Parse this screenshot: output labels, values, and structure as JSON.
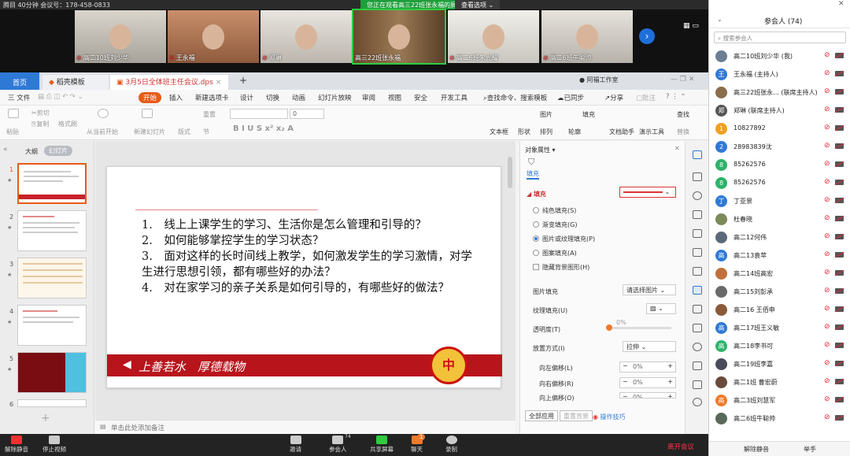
{
  "meeting": {
    "info": "腾目 40分钟 会议号：178-458-0833",
    "viewing_banner": "您正在观看高三22班张永福的屏幕",
    "view_options": "查看选项 ⌄"
  },
  "video_tiles": [
    {
      "name": "高二10班刘少华"
    },
    {
      "name": "王永福"
    },
    {
      "name": "郑琳"
    },
    {
      "name": "高三22班张永福"
    },
    {
      "name": "高二6班朱光耀"
    },
    {
      "name": "高二6班牛聪帅"
    }
  ],
  "wps": {
    "tabs": {
      "home": "首页",
      "template": "稻壳模板",
      "doc": "3月5日全体班主任会议.dps",
      "add": "+"
    },
    "tab_right": "阿福工作室",
    "menu": [
      "三 文件",
      "开始",
      "插入",
      "新建选项卡",
      "设计",
      "切换",
      "动画",
      "幻灯片放映",
      "审阅",
      "视图",
      "安全",
      "开发工具"
    ],
    "menu_right": [
      "查找命令、搜索模板",
      "已同步",
      "分享",
      "批注"
    ],
    "ribbon": {
      "paste": "粘贴",
      "cut": "剪切",
      "copy": "复制",
      "format_painter": "格式刷",
      "from_start": "从当前开始",
      "new_slide": "新建幻灯片",
      "layout": "版式",
      "section": "节",
      "reset": "重置",
      "font_size": "0",
      "textbox": "文本框",
      "shape": "形状",
      "arrange": "排列",
      "outline": "轮廓",
      "picture": "图片",
      "fill": "填充",
      "find": "查找",
      "replace": "替换",
      "doc_assistant": "文档助手",
      "presentation_tools": "演示工具"
    },
    "thumbs_header": {
      "outline": "大纲",
      "slides": "幻灯片"
    },
    "slide_numbers": [
      "1",
      "2",
      "3",
      "4",
      "5",
      "6"
    ],
    "slide": {
      "lines": [
        "1.　线上上课学生的学习、生活你是怎么管理和引导的？",
        "2.　如何能够掌控学生的学习状态？",
        "3.　面对这样的长时间线上教学，如何激发学生的学习激情，对学生进行思想引领，都有哪些好的办法？",
        "4.　对在家学习的亲子关系是如何引导的，有哪些好的做法？"
      ],
      "band_text": "上善若水　厚德载物",
      "seal_text": "中"
    },
    "notes_placeholder": "单击此处添加备注",
    "props": {
      "title": "对象属性 ▾",
      "tab_fill": "填充",
      "section_fill": "◢ 填充",
      "fill_options": [
        "纯色填充(S)",
        "渐变填充(G)",
        "图片或纹理填充(P)",
        "图案填充(A)"
      ],
      "hide_bg": "隐藏背景图形(H)",
      "picture_fill_label": "图片填充",
      "picture_fill_value": "请选择图片",
      "texture_fill_label": "纹理填充(U)",
      "transparency_label": "透明度(T)",
      "transparency_value": "0%",
      "placement_label": "放置方式(I)",
      "placement_value": "拉伸",
      "offset_left_label": "向左偏移(L)",
      "offset_left_value": "0%",
      "offset_right_label": "向右偏移(R)",
      "offset_right_value": "0%",
      "offset_up_label": "向上偏移(O)",
      "offset_up_value": "0%",
      "apply_all": "全部应用",
      "reset_bg": "重置背景",
      "tips": "操作技巧"
    }
  },
  "participants": {
    "title": "参会人 (74)",
    "search_placeholder": "搜索参会人",
    "list": [
      {
        "name": "高二10班刘少华 (我)",
        "avatar": "",
        "color": "#6a7f92"
      },
      {
        "name": "王永福 (主持人)",
        "avatar": "王",
        "color": "#2f79d6"
      },
      {
        "name": "高三22班张永... (联席主持人)",
        "avatar": "",
        "color": "#8a6d4b"
      },
      {
        "name": "郑琳 (联席主持人)",
        "avatar": "郑",
        "color": "#555555"
      },
      {
        "name": "10827892",
        "avatar": "1",
        "color": "#f0a020"
      },
      {
        "name": "28983839沈",
        "avatar": "2",
        "color": "#2f79d6"
      },
      {
        "name": "85262576",
        "avatar": "8",
        "color": "#2db36a"
      },
      {
        "name": "85262576",
        "avatar": "8",
        "color": "#2db36a"
      },
      {
        "name": "丁亚景",
        "avatar": "丁",
        "color": "#2f79d6"
      },
      {
        "name": "杜春晓",
        "avatar": "",
        "color": "#7a8a5a"
      },
      {
        "name": "高二12何伟",
        "avatar": "",
        "color": "#5a6a7a"
      },
      {
        "name": "高二13袁苹",
        "avatar": "高",
        "color": "#2f79d6"
      },
      {
        "name": "高二14班高宏",
        "avatar": "",
        "color": "#c0703a"
      },
      {
        "name": "高二15刘彭承",
        "avatar": "",
        "color": "#6a6a6a"
      },
      {
        "name": "高二16 王佰申",
        "avatar": "",
        "color": "#8a5a3a"
      },
      {
        "name": "高二17班王义敏",
        "avatar": "高",
        "color": "#2f79d6"
      },
      {
        "name": "高二18李书可",
        "avatar": "高",
        "color": "#2db36a"
      },
      {
        "name": "高二19班李嘉",
        "avatar": "",
        "color": "#4a4a5a"
      },
      {
        "name": "高二1班 曹宏蔚",
        "avatar": "",
        "color": "#6a4a3a"
      },
      {
        "name": "高二3班刘慧军",
        "avatar": "高",
        "color": "#f07a2b"
      },
      {
        "name": "高二6班牛聪帅",
        "avatar": "",
        "color": "#5a6a5a"
      }
    ],
    "footer": {
      "mute_all": "解除静音",
      "raise_hand": "举手"
    }
  },
  "bottom_bar": {
    "unmute": "解除静音",
    "stop_video": "停止视频",
    "invite": "邀请",
    "members": "参会人",
    "members_count": "74",
    "share": "共享屏幕",
    "chat": "聊天",
    "chat_badge": "1",
    "record": "录制",
    "leave": "离开会议"
  }
}
